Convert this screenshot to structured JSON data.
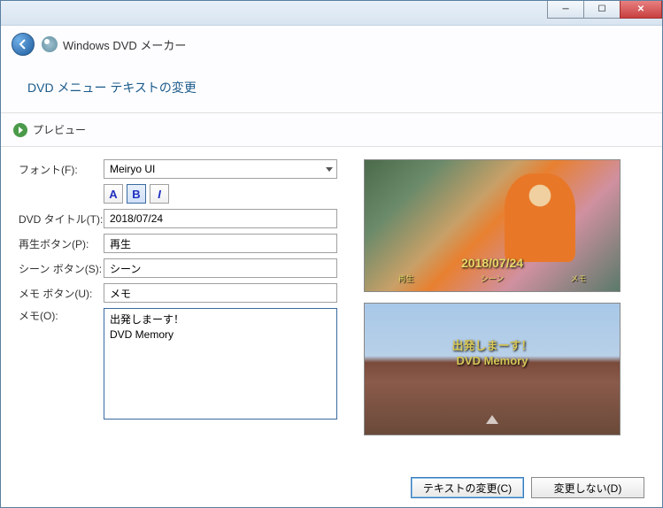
{
  "titlebar": {
    "min": "─",
    "max": "☐",
    "close": "✕"
  },
  "header": {
    "app_title": "Windows DVD メーカー"
  },
  "subheader": {
    "title": "DVD メニュー テキストの変更"
  },
  "preview_bar": {
    "label": "プレビュー"
  },
  "form": {
    "font_label": "フォント(F):",
    "font_value": "Meiryo UI",
    "style_color": "A",
    "style_bold": "B",
    "style_italic": "I",
    "dvd_title_label": "DVD タイトル(T):",
    "dvd_title_value": "2018/07/24",
    "play_label": "再生ボタン(P):",
    "play_value": "再生",
    "scene_label": "シーン ボタン(S):",
    "scene_value": "シーン",
    "memo_btn_label": "メモ ボタン(U):",
    "memo_btn_value": "メモ",
    "memo_label": "メモ(O):",
    "memo_value": "出発しまーす！\nDVD Memory"
  },
  "preview": {
    "top_title": "2018/07/24",
    "top_menu_play": "再生",
    "top_menu_scene": "シーン",
    "top_menu_memo": "メモ",
    "bottom_line1": "出発しまーす！",
    "bottom_line2": "DVD Memory"
  },
  "footer": {
    "change": "テキストの変更(C)",
    "cancel": "変更しない(D)"
  }
}
